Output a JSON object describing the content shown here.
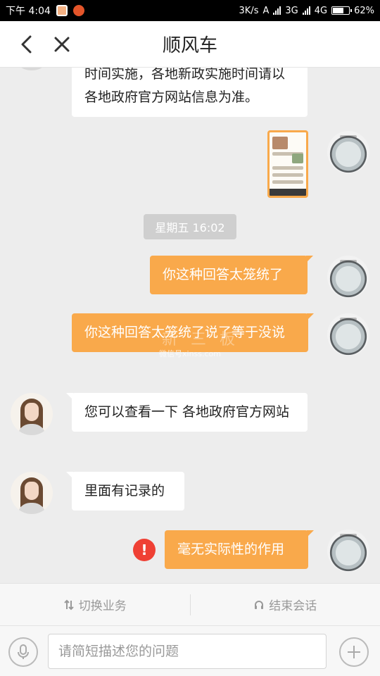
{
  "status_bar": {
    "time": "下午 4:04",
    "network_speed": "3K/s",
    "net_3g": "3G",
    "net_4g": "4G",
    "battery": "62%"
  },
  "header": {
    "title": "顺风车"
  },
  "messages": [
    {
      "from": "agent",
      "text": "时间实施，各地新政实施时间请以各地政府官方网站信息为准。"
    },
    {
      "from": "user",
      "type": "image"
    },
    {
      "type": "timestamp",
      "text": "星期五 16:02"
    },
    {
      "from": "user",
      "text": "你这种回答太笼统了"
    },
    {
      "from": "user",
      "text": "你这种回答太笼统了说了等于没说"
    },
    {
      "from": "agent",
      "text": "您可以查看一下 各地政府官方网站"
    },
    {
      "from": "agent",
      "text": "里面有记录的"
    },
    {
      "from": "user",
      "text": "毫无实际性的作用",
      "status": "failed"
    }
  ],
  "watermark": {
    "text": "微信号xinss.com",
    "big": "新 三 板"
  },
  "action_bar": {
    "switch_label": "切换业务",
    "end_label": "结束会话"
  },
  "input": {
    "placeholder": "请简短描述您的问题"
  },
  "colors": {
    "orange_bubble": "#f9a94b",
    "error_red": "#ef4034"
  }
}
